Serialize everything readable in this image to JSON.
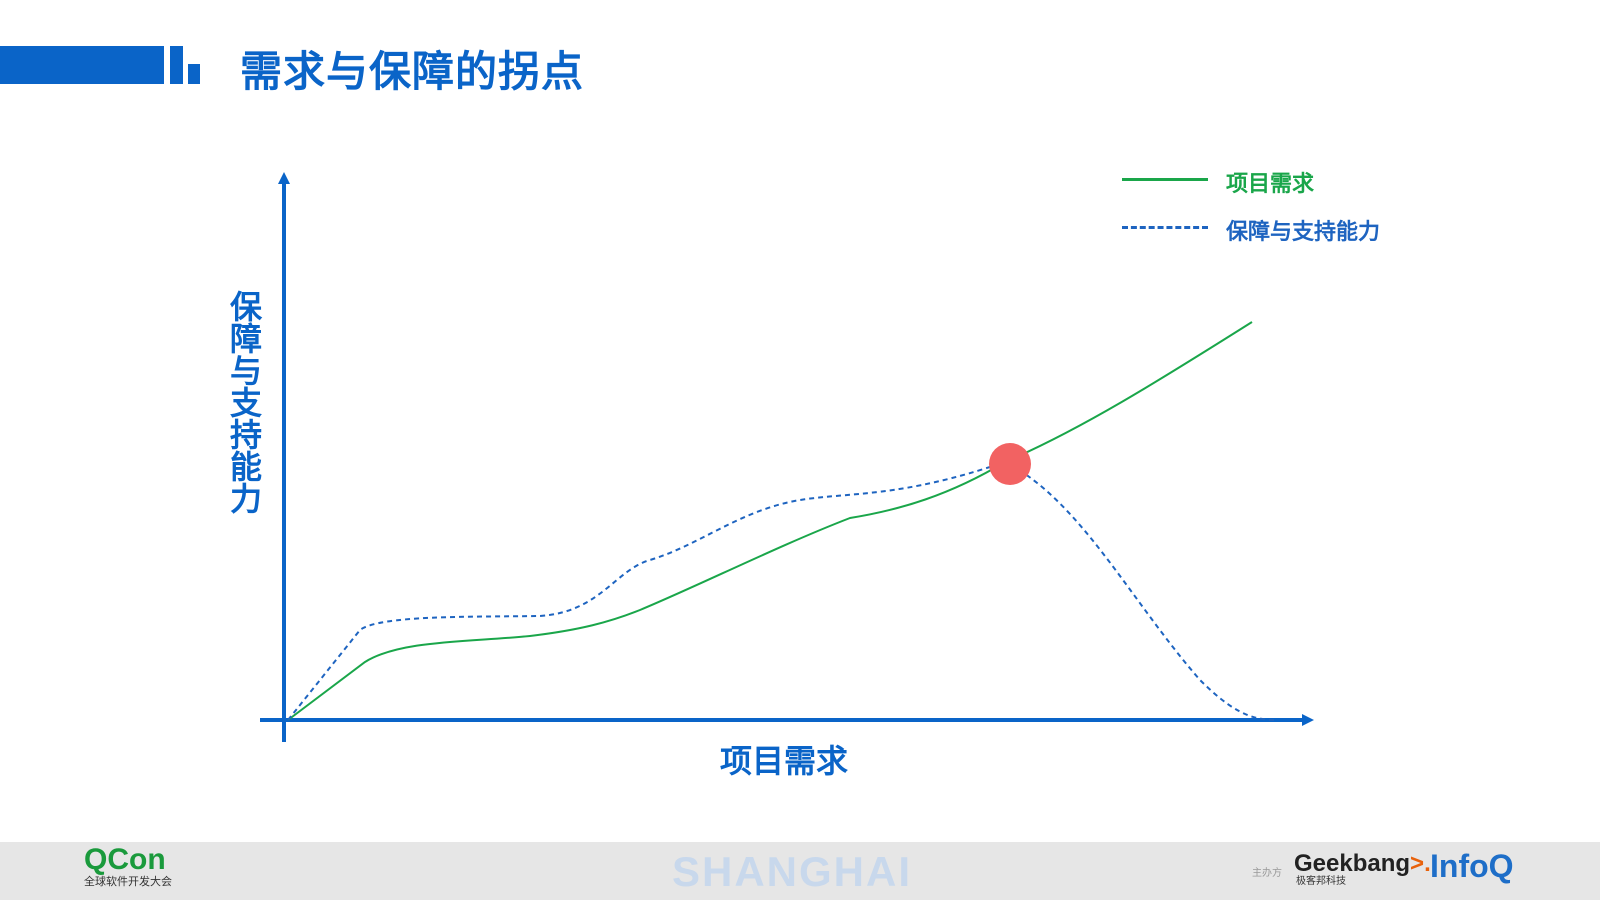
{
  "slide": {
    "title": "需求与保障的拐点"
  },
  "diagram": {
    "y_axis_label": "保障与支持能力",
    "x_axis_label": "项目需求",
    "legend": [
      {
        "label": "项目需求",
        "color": "#1aa64a",
        "style": "solid"
      },
      {
        "label": "保障与支持能力",
        "color": "#1e64c0",
        "style": "dashed"
      }
    ],
    "marker_color": "#f26262",
    "axis_color": "#0a64c8"
  },
  "footer": {
    "qcon": "QCon",
    "qcon_sub": "全球软件开发大会",
    "city": "SHANGHAI",
    "organizer": "主办方",
    "geekbang": "Geekbang",
    "geekbang_arrow": ">.",
    "geekbang_sub": "极客邦科技",
    "infoq": "InfoQ"
  }
}
